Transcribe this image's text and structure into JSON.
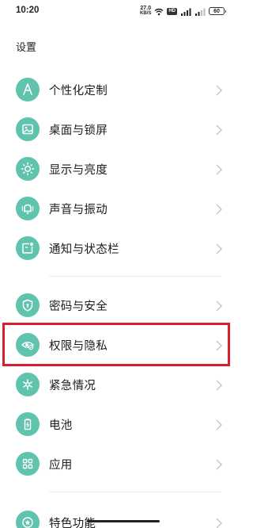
{
  "status_bar": {
    "time": "10:20",
    "net_speed_value": "27.0",
    "net_speed_unit": "KB/S",
    "badge_hd": "HD",
    "battery_level": "60"
  },
  "header": {
    "title": "设置"
  },
  "settings": {
    "items": [
      {
        "label": "个性化定制",
        "icon": "personalize-icon"
      },
      {
        "label": "桌面与锁屏",
        "icon": "image-icon"
      },
      {
        "label": "显示与亮度",
        "icon": "sun-icon"
      },
      {
        "label": "声音与振动",
        "icon": "bell-icon"
      },
      {
        "label": "通知与状态栏",
        "icon": "notification-icon"
      },
      {
        "label": "密码与安全",
        "icon": "shield-icon"
      },
      {
        "label": "权限与隐私",
        "icon": "privacy-eye-icon"
      },
      {
        "label": "紧急情况",
        "icon": "emergency-icon"
      },
      {
        "label": "电池",
        "icon": "battery-icon"
      },
      {
        "label": "应用",
        "icon": "apps-grid-icon"
      },
      {
        "label": "特色功能",
        "icon": "star-icon"
      }
    ]
  },
  "colors": {
    "icon_bg": "#5fc3ad",
    "highlight": "#d9202a"
  }
}
